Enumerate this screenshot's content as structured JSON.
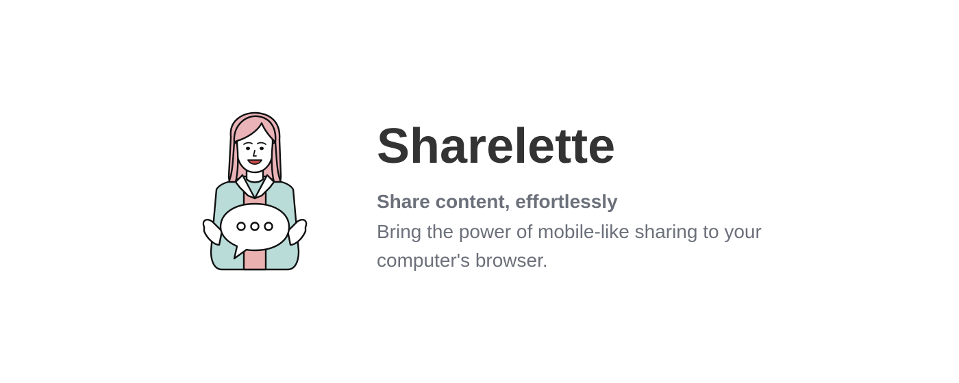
{
  "app": {
    "title": "Sharelette",
    "tagline": "Share content, effortlessly",
    "description": "Bring the power of mobile-like sharing to your computer's browser."
  },
  "illustration": {
    "icon": "woman-holding-speech-bubble-icon",
    "colors": {
      "hair": "#eab3b8",
      "jacket": "#b9dcd9",
      "shirt": "#e9b2b1",
      "skin": "#ffffff",
      "outline": "#111111"
    }
  },
  "colors": {
    "title": "#333333",
    "text": "#6b707a",
    "background": "#ffffff"
  }
}
